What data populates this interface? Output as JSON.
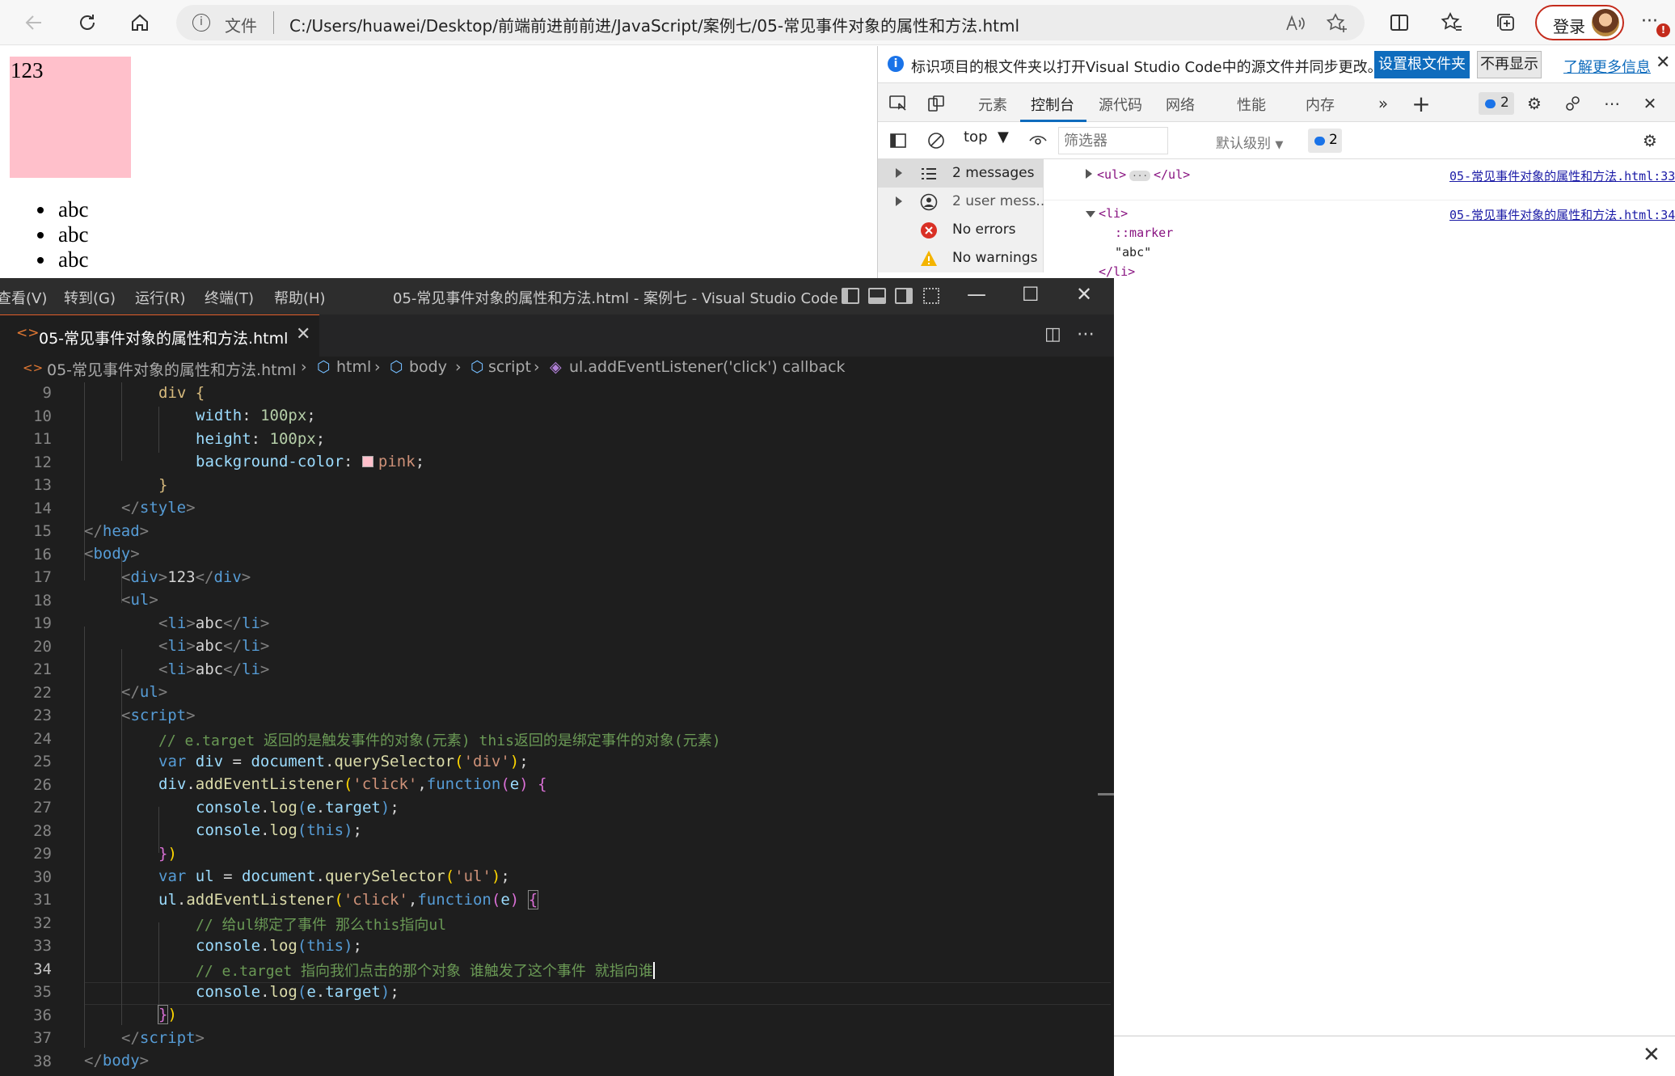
{
  "browser": {
    "url_scheme": "文件",
    "url": "C:/Users/huawei/Desktop/前端前进前前进/JavaScript/案例七/05-常见事件对象的属性和方法.html",
    "login_label": "登录",
    "more_label": "···",
    "badge": "!"
  },
  "page": {
    "div_text": "123",
    "list_items": [
      "abc",
      "abc",
      "abc"
    ]
  },
  "devtools": {
    "infobar": {
      "text": "标识项目的根文件夹以打开Visual Studio Code中的源文件并同步更改。",
      "set_root_label": "设置根文件夹",
      "dismiss_label": "不再显示",
      "learn_more_label": "了解更多信息"
    },
    "tabs": [
      "元素",
      "控制台",
      "源代码",
      "网络",
      "性能",
      "内存"
    ],
    "active_tab": "控制台",
    "issues_count": "2",
    "context": "top",
    "filter_placeholder": "筛选器",
    "level_label": "默认级别",
    "level_count": "2",
    "sidebar": [
      {
        "label": "2 messages",
        "icon": "list-icon"
      },
      {
        "label": "2 user mess...",
        "icon": "user-icon"
      },
      {
        "label": "No errors",
        "icon": "error-icon"
      },
      {
        "label": "No warnings",
        "icon": "warning-icon"
      }
    ],
    "log": {
      "line1": {
        "open": "<ul>",
        "ellipsis": "···",
        "close": "</ul>",
        "source": "05-常见事件对象的属性和方法.html:33"
      },
      "line2": {
        "open": "<li>",
        "marker": "::marker",
        "text": "\"abc\"",
        "close": "</li>",
        "source": "05-常见事件对象的属性和方法.html:34"
      }
    },
    "accent": "#0f6cbd"
  },
  "vscode": {
    "menus": [
      "查看(V)",
      "转到(G)",
      "运行(R)",
      "终端(T)",
      "帮助(H)"
    ],
    "title": "05-常见事件对象的属性和方法.html - 案例七 - Visual Studio Code",
    "tab_label": "05-常见事件对象的属性和方法.html",
    "breadcrumb": [
      "05-常见事件对象的属性和方法.html",
      "html",
      "body",
      "script",
      "ul.addEventListener('click') callback"
    ],
    "current_line": "34",
    "line_numbers": [
      "9",
      "10",
      "11",
      "12",
      "13",
      "14",
      "15",
      "16",
      "17",
      "18",
      "19",
      "20",
      "21",
      "22",
      "23",
      "24",
      "25",
      "26",
      "27",
      "28",
      "29",
      "30",
      "31",
      "32",
      "33",
      "34",
      "35",
      "36",
      "37",
      "38"
    ],
    "code": {
      "l9": "div {",
      "l10a": "width",
      "l10b": "100px",
      "l11a": "height",
      "l11b": "100px",
      "l12a": "background-color",
      "l12b": "pink",
      "l13": "}",
      "l14": "style",
      "l15": "head",
      "l16": "body",
      "l17a": "div",
      "l17b": "123",
      "l18": "ul",
      "li_tag": "li",
      "li_text": "abc",
      "l22": "ul",
      "l23": "script",
      "l24": "// e.target 返回的是触发事件的对象(元素) this返回的是绑定事件的对象(元素)",
      "var": "var",
      "function": "function",
      "div_var": "div",
      "document": "document",
      "qs": "querySelector",
      "s_div": "'div'",
      "s_click": "'click'",
      "s_ul": "'ul'",
      "ael": "addEventListener",
      "e": "e",
      "console": "console",
      "log": "log",
      "target": "target",
      "this": "this",
      "ul_var": "ul",
      "l32": "// 给ul绑定了事件 那么this指向ul",
      "l34": "// e.target 指向我们点击的那个对象 谁触发了这个事件 就指向谁",
      "l37": "script",
      "l38": "body"
    }
  }
}
